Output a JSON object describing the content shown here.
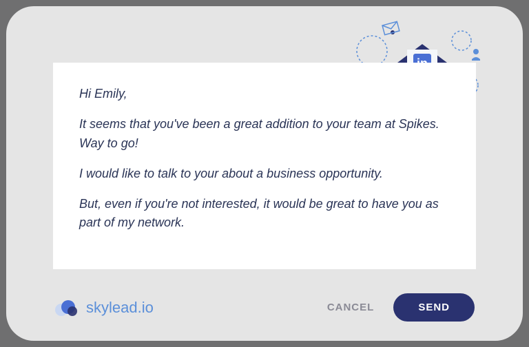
{
  "message": {
    "greeting": "Hi Emily,",
    "p1": "It seems that you've been a great addition to your team at Spikes. Way to go!",
    "p2": "I would like to talk to your about a business opportunity.",
    "p3": "But, even if you're not interested, it would be great to have you as part of my network."
  },
  "brand": {
    "name": "skylead.io"
  },
  "actions": {
    "cancel": "CANCEL",
    "send": "SEND"
  }
}
